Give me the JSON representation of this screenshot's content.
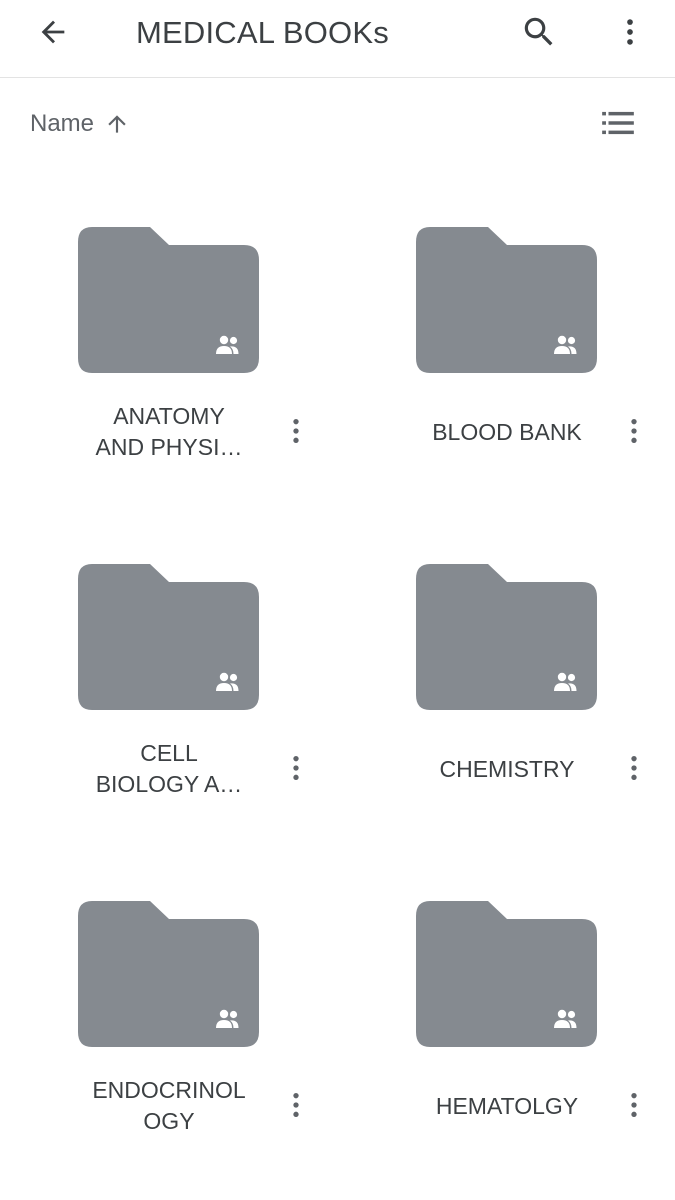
{
  "header": {
    "title": "MEDICAL BOOKs",
    "back_icon": "arrow-back-icon",
    "search_icon": "search-icon",
    "menu_icon": "more-vert-icon"
  },
  "sort": {
    "label": "Name",
    "direction_icon": "arrow-up-icon",
    "view_toggle_icon": "list-view-icon"
  },
  "folders": [
    {
      "label": "ANATOMY\nAND PHYSI…",
      "icon": "shared-folder-icon"
    },
    {
      "label": "BLOOD BANK",
      "icon": "shared-folder-icon"
    },
    {
      "label": "CELL\nBIOLOGY A…",
      "icon": "shared-folder-icon"
    },
    {
      "label": "CHEMISTRY",
      "icon": "shared-folder-icon"
    },
    {
      "label": "ENDOCRINOL\nOGY",
      "icon": "shared-folder-icon"
    },
    {
      "label": "HEMATOLGY",
      "icon": "shared-folder-icon"
    }
  ],
  "colors": {
    "folder": "#858a90",
    "icon": "#5f6368",
    "text": "#3c4043"
  }
}
